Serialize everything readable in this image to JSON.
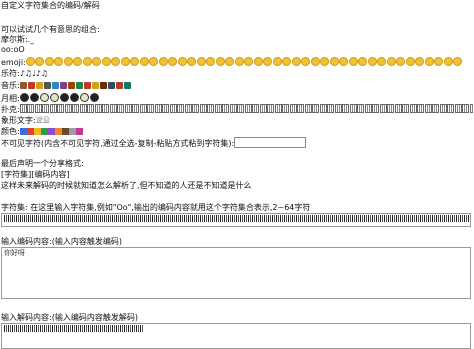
{
  "page": {
    "title": "自定义字符集合的编码/解码",
    "intro": "可以试试几个有意思的组合:",
    "rows": {
      "morse_label": "摩尔斯:",
      "morse_value": "._",
      "binary_value": "oo:oO",
      "emoji_label": "emoji:",
      "music_label": "乐符:",
      "music_value": "♪♫♩♪♫",
      "instrument_label": "音乐:",
      "moon_label": "月相:",
      "poker_label": "扑克:",
      "glyph_label": "象形文字:",
      "glyph_value": "𓀀𓀁",
      "color_label": "颜色:",
      "invisible_label": "不可见字符(内含不可见字符,通过全选-复制-粘贴方式粘到字符集):"
    },
    "share_heading": "最后声明一个分享格式:",
    "share_format": "[字符集][编码内容]",
    "share_note": "这样未来解码的时候就知道怎么解析了,但不知道的人还是不知道是什么",
    "charset_label": "字符集: 在这里输入字符集,例如\"Oo\",输出的编码内容就用这个字符集合表示,2~64字符",
    "encode_label": "输入编码内容:(输入内容触发编码)",
    "encode_value": "你好呀",
    "decode_label": "输入解码内容:(输入编码内容触发解码)"
  },
  "icons": {
    "emoji": "smiley-face-icon",
    "moon": "moon-phase-icon",
    "instrument": "instrument-icon",
    "card": "playing-card-icon"
  },
  "colors": {
    "swatches": [
      "#3b6fd6",
      "#e0402f",
      "#f0b820",
      "#2e9b46",
      "#8a4fcf",
      "#f08a24",
      "#6b4a2b",
      "#9aa0a6",
      "#c7378f"
    ]
  }
}
